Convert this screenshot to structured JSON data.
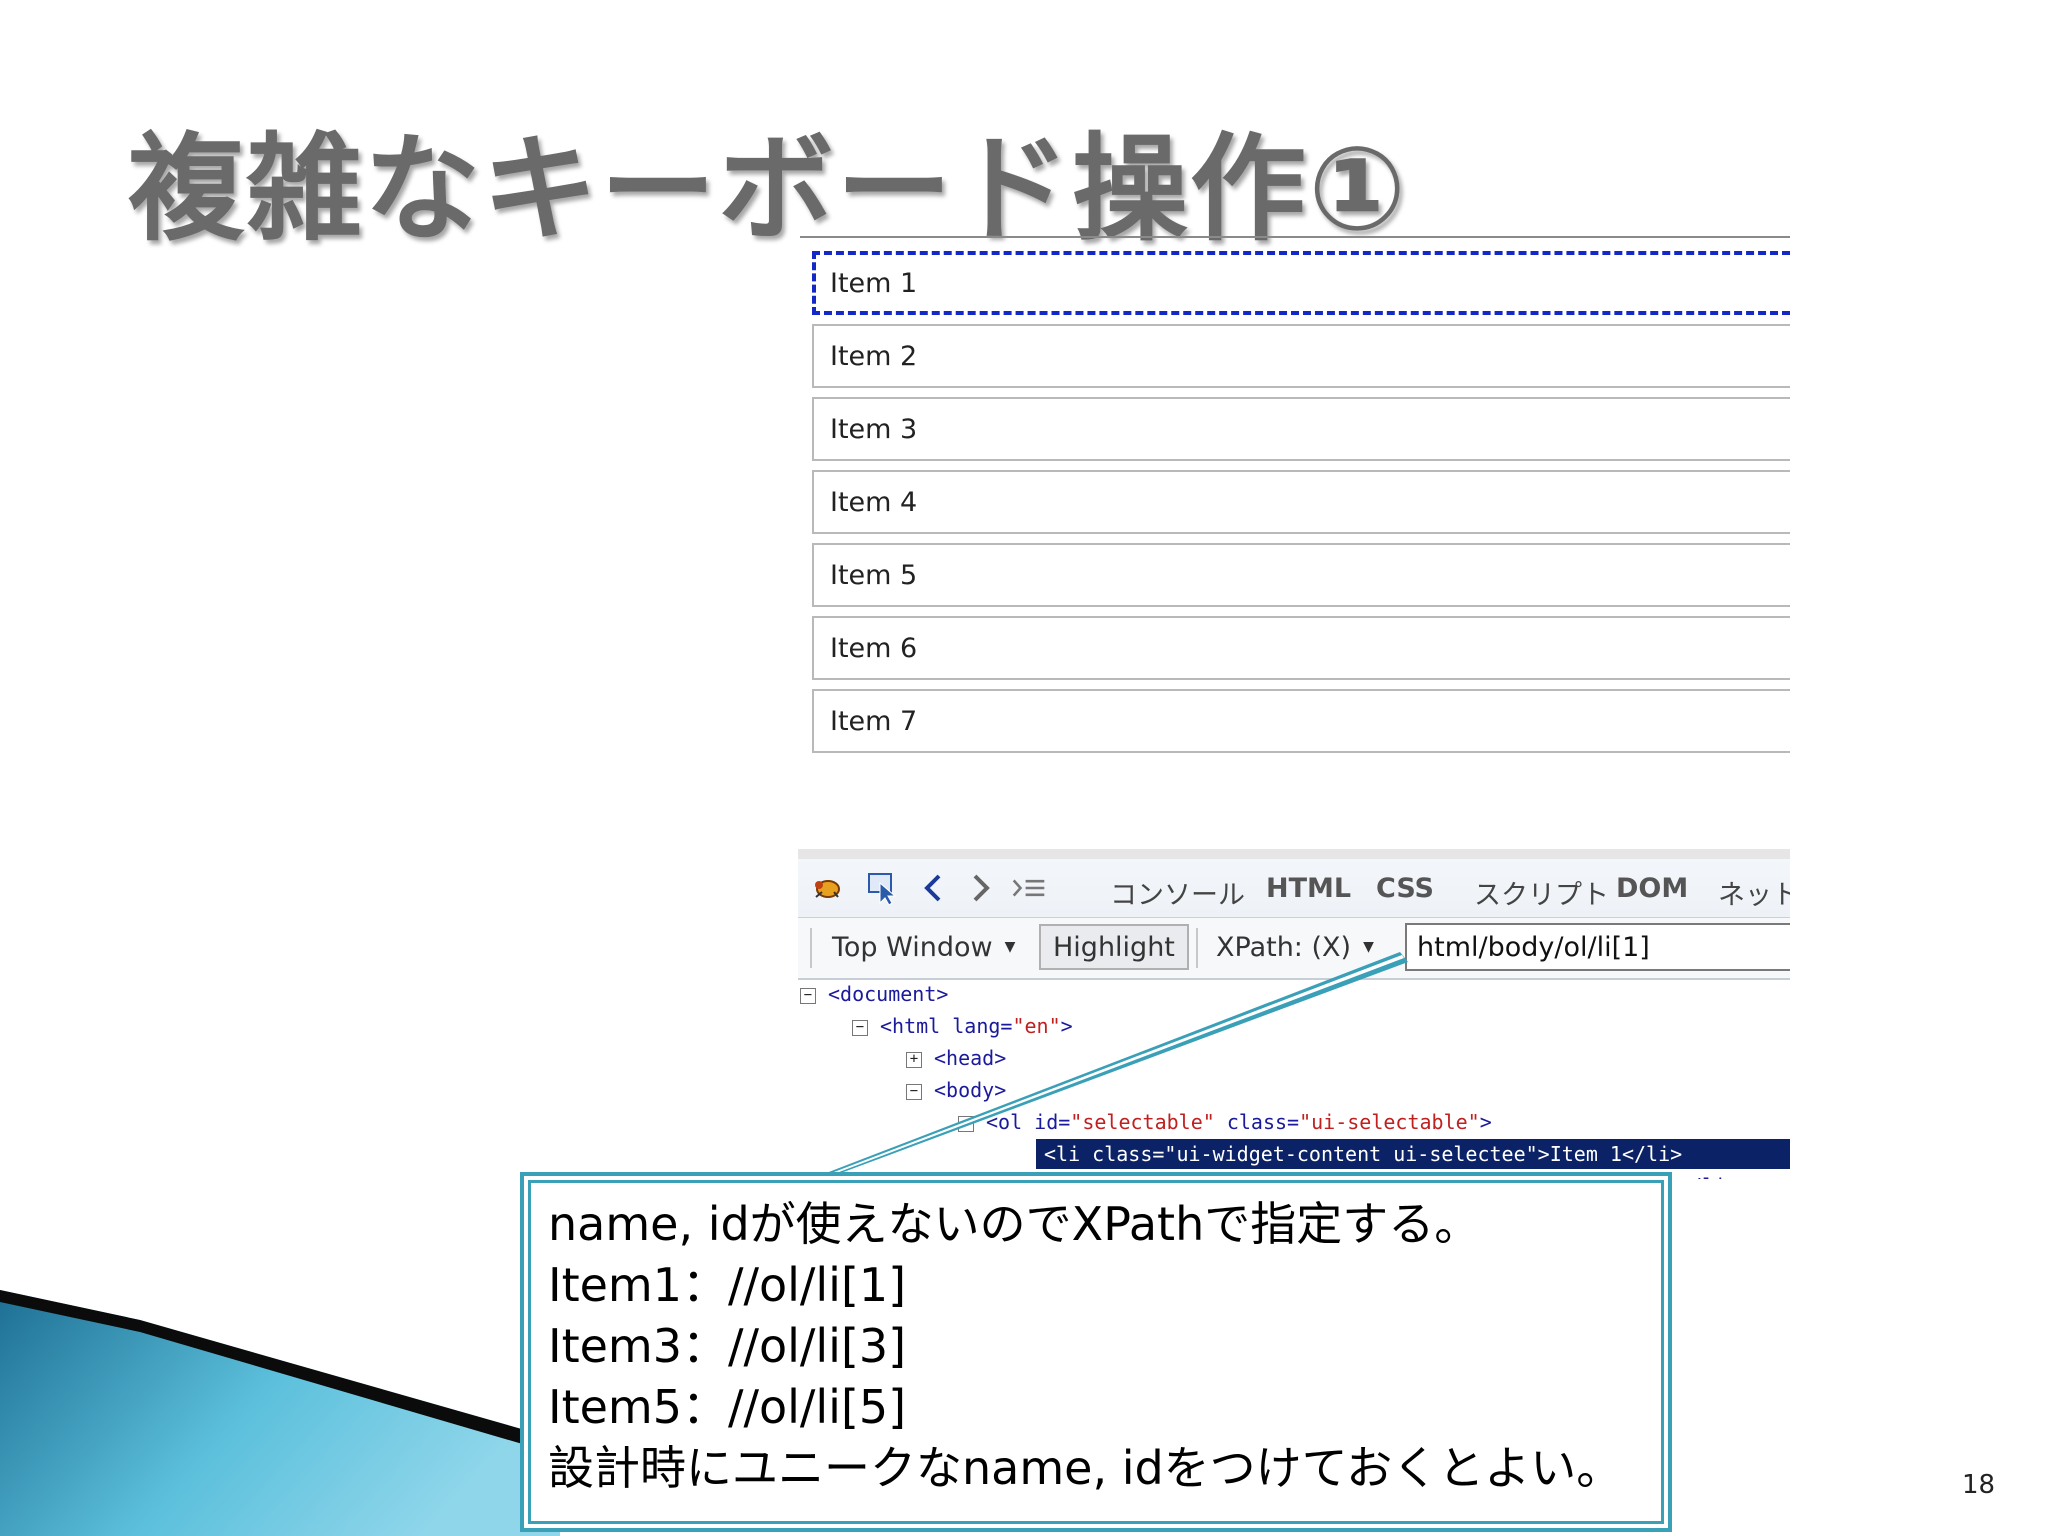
{
  "slide": {
    "title": "複雑なキーボード操作①",
    "page_number": "18"
  },
  "list": {
    "items": [
      "Item 1",
      "Item 2",
      "Item 3",
      "Item 4",
      "Item 5",
      "Item 6",
      "Item 7"
    ],
    "selected_index": 0
  },
  "devtools": {
    "icons": [
      "firebug-icon",
      "inspect-icon",
      "back-icon",
      "forward-icon",
      "command-line-icon"
    ],
    "tabs": [
      "コンソール",
      "HTML",
      "CSS",
      "スクリプト",
      "DOM",
      "ネット"
    ],
    "toolbar": {
      "window_select": "Top Window",
      "highlight_button": "Highlight",
      "xpath_label": "XPath: (X)",
      "xpath_value": "html/body/ol/li[1]"
    },
    "tree": {
      "document": "<document>",
      "html_open": "<html lang=",
      "html_lang": "\"en\"",
      "html_close": ">",
      "head": "<head>",
      "body": "<body>",
      "ol_open": "<ol id=",
      "ol_id": "\"selectable\"",
      "ol_class_attr": " class=",
      "ol_class": "\"ui-selectable\"",
      "ol_close": ">",
      "li_selected": "<li class=\"ui-widget-content ui-selectee\">Item 1</li>",
      "li_next_tail": "</li>"
    }
  },
  "callout": {
    "lines": [
      "name, idが使えないのでXPathで指定する。",
      "Item1：//ol/li[1]",
      "Item3：//ol/li[3]",
      "Item5：//ol/li[5]",
      "設計時にユニークなname, idをつけておくとよい。"
    ]
  },
  "colors": {
    "accent": "#3aa0b8",
    "selection_border": "#1428c8",
    "tree_highlight": "#0b2266",
    "decor_blue": "#2a8fb0"
  }
}
